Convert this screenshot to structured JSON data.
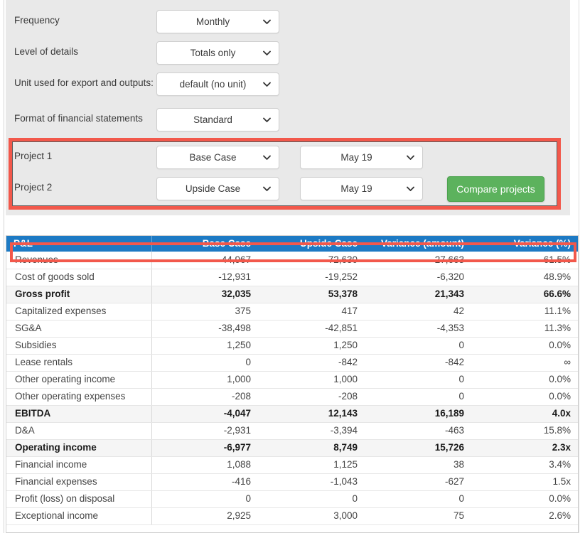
{
  "settings": {
    "rows": [
      {
        "label": "Frequency",
        "value": "Monthly"
      },
      {
        "label": "Level of details",
        "value": "Totals only"
      },
      {
        "label": "Unit used for export and outputs:",
        "value": "default (no unit)"
      },
      {
        "label": "Format of financial statements",
        "value": "Standard"
      }
    ]
  },
  "compare": {
    "project1_label": "Project 1",
    "project1_case": "Base Case",
    "project1_date": "May 19",
    "project2_label": "Project 2",
    "project2_case": "Upside Case",
    "project2_date": "May 19",
    "button_label": "Compare projects"
  },
  "colors": {
    "highlight": "#f2584b",
    "header_blue": "#1d7ac4",
    "button_green": "#5cb25d",
    "panel_gray": "#e9e9e9"
  },
  "table": {
    "headers": [
      "P&L",
      "Base Case",
      "Upside Case",
      "Variance (amount)",
      "Variance (%)"
    ],
    "rows": [
      {
        "label": "Revenues",
        "base": "44,967",
        "upside": "72,630",
        "var_amount": "27,663",
        "var_pct": "61.5%",
        "total": false
      },
      {
        "label": "Cost of goods sold",
        "base": "-12,931",
        "upside": "-19,252",
        "var_amount": "-6,320",
        "var_pct": "48.9%",
        "total": false
      },
      {
        "label": "Gross profit",
        "base": "32,035",
        "upside": "53,378",
        "var_amount": "21,343",
        "var_pct": "66.6%",
        "total": true
      },
      {
        "label": "Capitalized expenses",
        "base": "375",
        "upside": "417",
        "var_amount": "42",
        "var_pct": "11.1%",
        "total": false
      },
      {
        "label": "SG&A",
        "base": "-38,498",
        "upside": "-42,851",
        "var_amount": "-4,353",
        "var_pct": "11.3%",
        "total": false
      },
      {
        "label": "Subsidies",
        "base": "1,250",
        "upside": "1,250",
        "var_amount": "0",
        "var_pct": "0.0%",
        "total": false
      },
      {
        "label": "Lease rentals",
        "base": "0",
        "upside": "-842",
        "var_amount": "-842",
        "var_pct": "∞",
        "total": false
      },
      {
        "label": "Other operating income",
        "base": "1,000",
        "upside": "1,000",
        "var_amount": "0",
        "var_pct": "0.0%",
        "total": false
      },
      {
        "label": "Other operating expenses",
        "base": "-208",
        "upside": "-208",
        "var_amount": "0",
        "var_pct": "0.0%",
        "total": false
      },
      {
        "label": "EBITDA",
        "base": "-4,047",
        "upside": "12,143",
        "var_amount": "16,189",
        "var_pct": "4.0x",
        "total": true
      },
      {
        "label": "D&A",
        "base": "-2,931",
        "upside": "-3,394",
        "var_amount": "-463",
        "var_pct": "15.8%",
        "total": false
      },
      {
        "label": "Operating income",
        "base": "-6,977",
        "upside": "8,749",
        "var_amount": "15,726",
        "var_pct": "2.3x",
        "total": true
      },
      {
        "label": "Financial income",
        "base": "1,088",
        "upside": "1,125",
        "var_amount": "38",
        "var_pct": "3.4%",
        "total": false
      },
      {
        "label": "Financial expenses",
        "base": "-416",
        "upside": "-1,043",
        "var_amount": "-627",
        "var_pct": "1.5x",
        "total": false
      },
      {
        "label": "Profit (loss) on disposal",
        "base": "0",
        "upside": "0",
        "var_amount": "0",
        "var_pct": "0.0%",
        "total": false
      },
      {
        "label": "Exceptional income",
        "base": "2,925",
        "upside": "3,000",
        "var_amount": "75",
        "var_pct": "2.6%",
        "total": false
      }
    ]
  }
}
